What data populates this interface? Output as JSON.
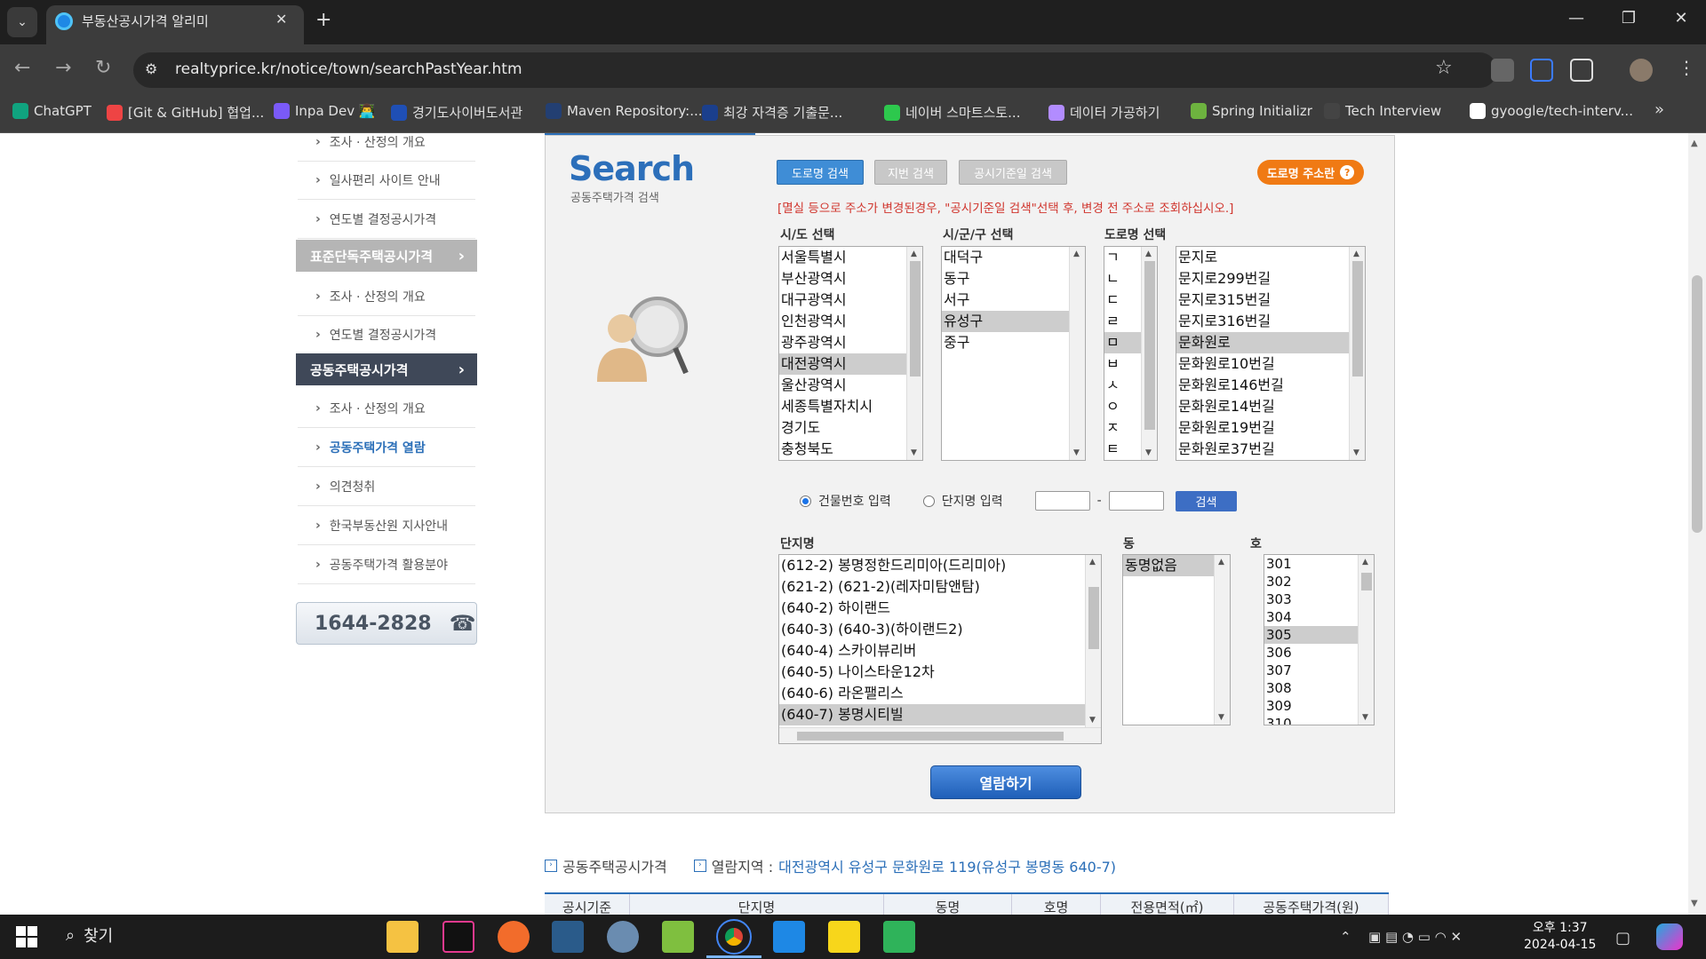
{
  "browser": {
    "tab_title": "부동산공시가격 알리미",
    "url": "realtyprice.kr/notice/town/searchPastYear.htm",
    "bookmarks": [
      "ChatGPT",
      "[Git & GitHub] 협업...",
      "Inpa Dev 👨‍💻",
      "경기도사이버도서관",
      "Maven Repository:...",
      "최강 자격증 기출문...",
      "네이버 스마트스토...",
      "데이터 가공하기",
      "Spring Initializr",
      "Tech Interview",
      "gyoogle/tech-interv..."
    ],
    "bookmark_colors": [
      "#10a37f",
      "#e44",
      "#7a5af8",
      "#1f4fb5",
      "#233f72",
      "#1b3f8c",
      "#2dc84d",
      "#b28cff",
      "#6db33f",
      "#444",
      "#fff"
    ]
  },
  "sidebar": {
    "items": [
      {
        "label": "조사 · 산정의 개요",
        "active": false
      },
      {
        "label": "일사편리 사이트 안내",
        "active": false
      },
      {
        "label": "연도별 결정공시가격",
        "active": false
      },
      {
        "label": "표준단독주택공시가격",
        "section": true
      },
      {
        "label": "조사 · 산정의 개요",
        "active": false
      },
      {
        "label": "연도별 결정공시가격",
        "active": false
      },
      {
        "label": "공동주택공시가격",
        "section": true
      },
      {
        "label": "조사 · 산정의 개요",
        "active": false
      },
      {
        "label": "공동주택가격 열람",
        "active": true
      },
      {
        "label": "의견청취",
        "active": false
      },
      {
        "label": "한국부동산원 지사안내",
        "active": false
      },
      {
        "label": "공동주택가격 활용분야",
        "active": false
      }
    ],
    "phone": "1644-2828"
  },
  "search": {
    "title": "Search",
    "subtitle": "공동주택가격 검색",
    "tabs": {
      "road": "도로명 검색",
      "lot": "지번 검색",
      "date": "공시기준일 검색"
    },
    "road_info": "도로명 주소란",
    "notice": "[멸실 등으로 주소가 변경된경우, \"공시기준일 검색\"선택 후, 변경 전 주소로 조회하십시오.]",
    "sido_label": "시/도 선택",
    "sido": [
      "서울특별시",
      "부산광역시",
      "대구광역시",
      "인천광역시",
      "광주광역시",
      "대전광역시",
      "울산광역시",
      "세종특별자치시",
      "경기도",
      "충청북도"
    ],
    "sido_selected": 5,
    "sigungu_label": "시/군/구 선택",
    "sigungu": [
      "대덕구",
      "동구",
      "서구",
      "유성구",
      "중구"
    ],
    "sigungu_selected": 3,
    "road_label": "도로명 선택",
    "initials": [
      "ㄱ",
      "ㄴ",
      "ㄷ",
      "ㄹ",
      "ㅁ",
      "ㅂ",
      "ㅅ",
      "ㅇ",
      "ㅈ",
      "ㅌ"
    ],
    "initials_selected": 4,
    "roads": [
      "문지로",
      "문지로299번길",
      "문지로315번길",
      "문지로316번길",
      "문화원로",
      "문화원로10번길",
      "문화원로146번길",
      "문화원로14번길",
      "문화원로19번길",
      "문화원로37번길"
    ],
    "roads_selected": 4,
    "radio_building": "건물번호 입력",
    "radio_complex": "단지명 입력",
    "dash": "-",
    "search_btn": "검색",
    "complex_label": "단지명",
    "complexes": [
      "(612-2) 봉명정한드리미아(드리미아)",
      "(621-2) (621-2)(레자미탐앤탐)",
      "(640-2) 하이랜드",
      "(640-3) (640-3)(하이랜드2)",
      "(640-4) 스카이뷰리버",
      "(640-5) 나이스타운12차",
      "(640-6) 라온팰리스",
      "(640-7) 봉명시티빌"
    ],
    "complex_selected": 7,
    "dong_label": "동",
    "dongs": [
      "동명없음"
    ],
    "ho_label": "호",
    "hos": [
      "301",
      "302",
      "303",
      "304",
      "305",
      "306",
      "307",
      "308",
      "309",
      "310"
    ],
    "ho_selected": 4,
    "view_btn": "열람하기"
  },
  "result": {
    "title": "공동주택공시가격",
    "region_label": "열람지역 :",
    "region": "대전광역시 유성구 문화원로 119(유성구 봉명동 640-7)",
    "columns": [
      "공시기준",
      "단지명",
      "동명",
      "호명",
      "전용면적(㎡)",
      "공동주택가격(원)"
    ]
  },
  "taskbar": {
    "search": "찾기",
    "time": "오후 1:37",
    "date": "2024-04-15"
  }
}
